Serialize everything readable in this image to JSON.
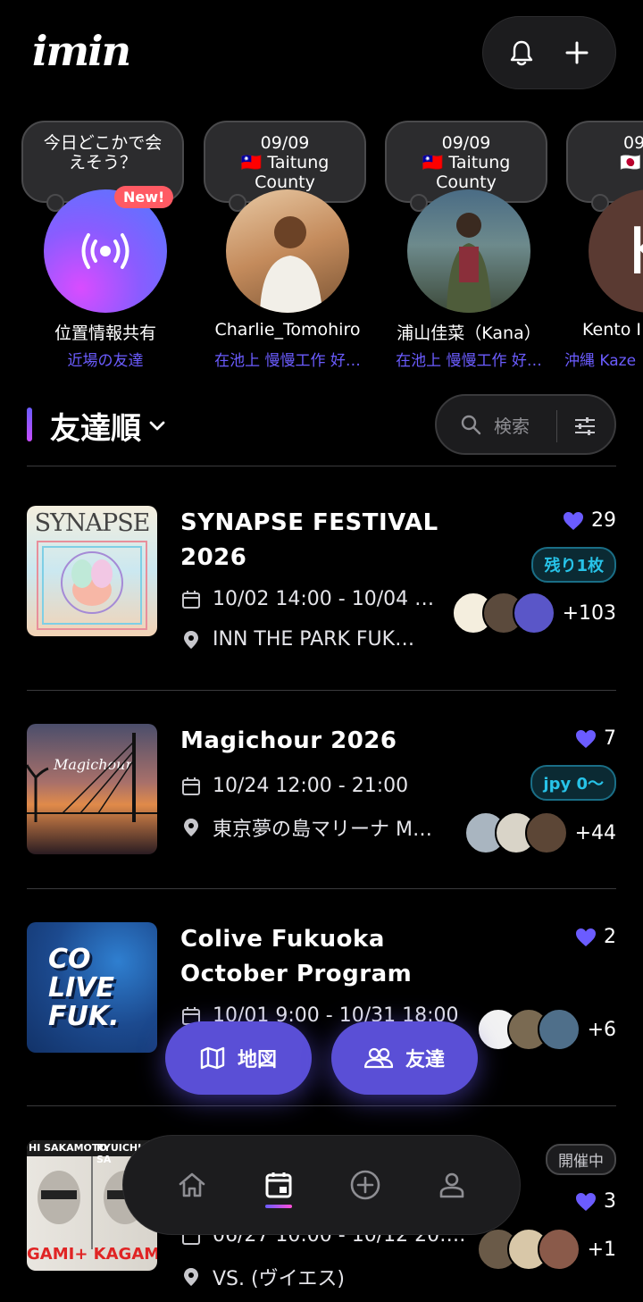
{
  "app": {
    "logo": "imin"
  },
  "header": {
    "bell_icon": "bell-icon",
    "add_icon": "plus-icon"
  },
  "stories": [
    {
      "bubble": "今日どこかで会えそう？",
      "name": "位置情報共有",
      "sub": "近場の友達",
      "badge": "New!"
    },
    {
      "bubble_date": "09/09",
      "bubble_place": "🇹🇼 Taitung County",
      "name": "Charlie_Tomohiro",
      "sub": "在池上 慢慢工作 好…"
    },
    {
      "bubble_date": "09/09",
      "bubble_place": "🇹🇼 Taitung County",
      "name": "浦山佳菜（Kana）",
      "sub": "在池上 慢慢工作 好…"
    },
    {
      "bubble_date": "09",
      "bubble_place": "🇯🇵 Ol",
      "name": "Kento I",
      "sub": "沖縄 Kaze",
      "initial": "K"
    }
  ],
  "section": {
    "title": "友達順",
    "search_placeholder": "検索"
  },
  "events": [
    {
      "title": "SYNAPSE FESTIVAL 2026",
      "datetime": "10/02 14:00 - 10/04 …",
      "location": "INN THE PARK FUK…",
      "likes": "29",
      "tag": "残り1枚",
      "attendee_count": "+103",
      "thumb_text": "SYNAPSE"
    },
    {
      "title": "Magichour 2026",
      "datetime": "10/24 12:00 - 21:00",
      "location": "東京夢の島マリーナ M…",
      "likes": "7",
      "tag": "jpy 0〜",
      "attendee_count": "+44",
      "thumb_text": "Magichour"
    },
    {
      "title": "Colive Fukuoka October Program",
      "datetime": "10/01 9:00 - 10/31 18:00",
      "likes": "2",
      "attendee_count": "+6",
      "thumb_text": "CO LIVE FUK."
    },
    {
      "status": "開催中",
      "datetime": "06/27 10:00 - 10/12 20:…",
      "location": "VS. (ヴイエス)",
      "likes": "3",
      "attendee_count": "+1",
      "thumb_text_left": "HI SAKAMOTO",
      "thumb_text_right": "RYUICHI SA",
      "thumb_bottom": "GAMI+ KAGAM"
    }
  ],
  "floating": {
    "map_label": "地図",
    "friends_label": "友達"
  },
  "bottom_nav": [
    {
      "icon": "home-icon"
    },
    {
      "icon": "calendar-icon",
      "active": true
    },
    {
      "icon": "add-circle-icon"
    },
    {
      "icon": "profile-icon"
    }
  ],
  "colors": {
    "accent": "#5a4fd6",
    "tag": "#27c3e8",
    "heart": "#6b5cff"
  }
}
